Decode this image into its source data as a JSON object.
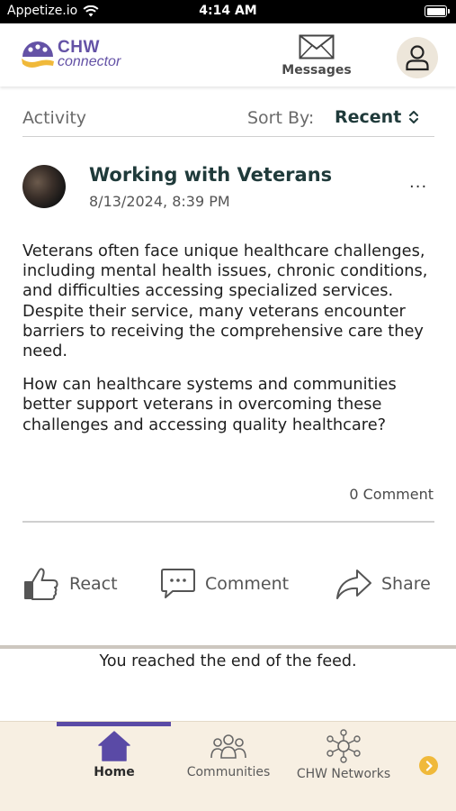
{
  "status_bar": {
    "carrier": "Appetize.io",
    "time": "4:14 AM"
  },
  "header": {
    "logo_chw": "CHW",
    "logo_connector": "connector",
    "messages_label": "Messages"
  },
  "activity": {
    "title": "Activity",
    "sort_label": "Sort By:",
    "sort_value": "Recent"
  },
  "post": {
    "title": "Working with Veterans",
    "date": "8/13/2024, 8:39 PM",
    "menu": "...",
    "body_paragraph_1": "Veterans often face unique healthcare challenges, including mental health issues, chronic conditions, and difficulties accessing specialized services. Despite their service, many veterans encounter barriers to receiving the comprehensive care they need.",
    "body_paragraph_2": "How can healthcare systems and communities better support veterans in overcoming these challenges and accessing quality healthcare?",
    "comment_count": "0 Comment",
    "actions": {
      "react": "React",
      "comment": "Comment",
      "share": "Share"
    }
  },
  "feed": {
    "end_message": "You reached the end of the feed."
  },
  "bottom_nav": {
    "items": [
      {
        "label": "Home",
        "icon": "home-icon",
        "active": true
      },
      {
        "label": "Communities",
        "icon": "people-group-icon",
        "active": false
      },
      {
        "label": "CHW Networks",
        "icon": "network-icon",
        "active": false
      }
    ],
    "more_icon": "chevron-right-icon"
  },
  "colors": {
    "brand_purple": "#6452a6",
    "nav_indicator": "#5a4aa6",
    "nav_background": "#f7efe2",
    "title_dark": "#1f3a3a",
    "more_button": "#f0b93a"
  }
}
